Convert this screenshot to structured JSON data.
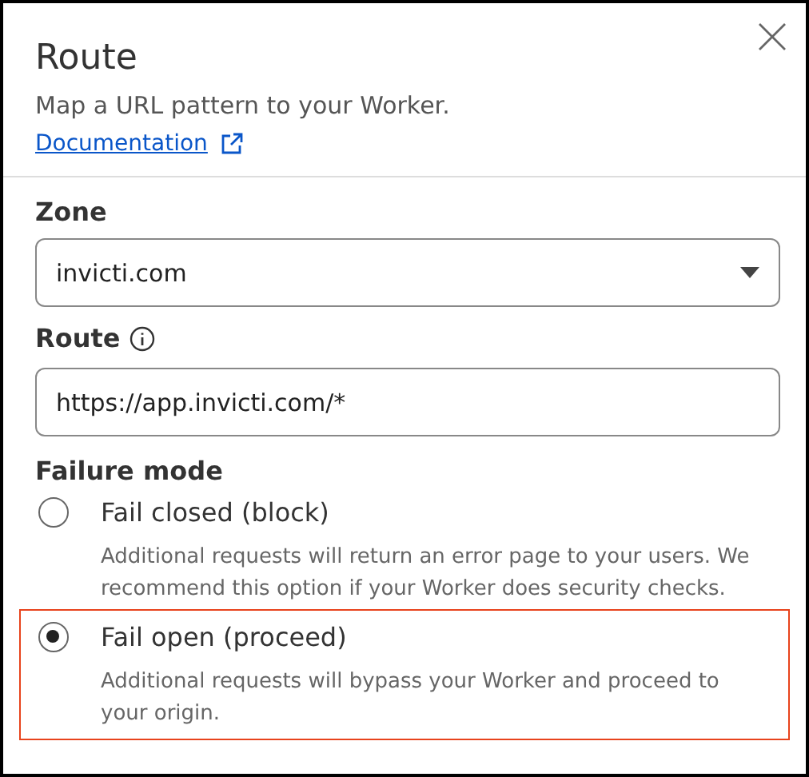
{
  "panel": {
    "title": "Route",
    "subtitle": "Map a URL pattern to your Worker.",
    "link": "Documentation"
  },
  "zone": {
    "label": "Zone",
    "value": "invicti.com"
  },
  "route": {
    "label": "Route",
    "value": "https://app.invicti.com/*"
  },
  "failure_mode": {
    "label": "Failure mode",
    "options": [
      {
        "label": "Fail closed (block)",
        "description": "Additional requests will return an error page to your users. We recommend this option if your Worker does security checks.",
        "selected": false,
        "highlighted": false
      },
      {
        "label": "Fail open (proceed)",
        "description": "Additional requests will bypass your Worker and proceed to your origin.",
        "selected": true,
        "highlighted": true
      }
    ]
  }
}
